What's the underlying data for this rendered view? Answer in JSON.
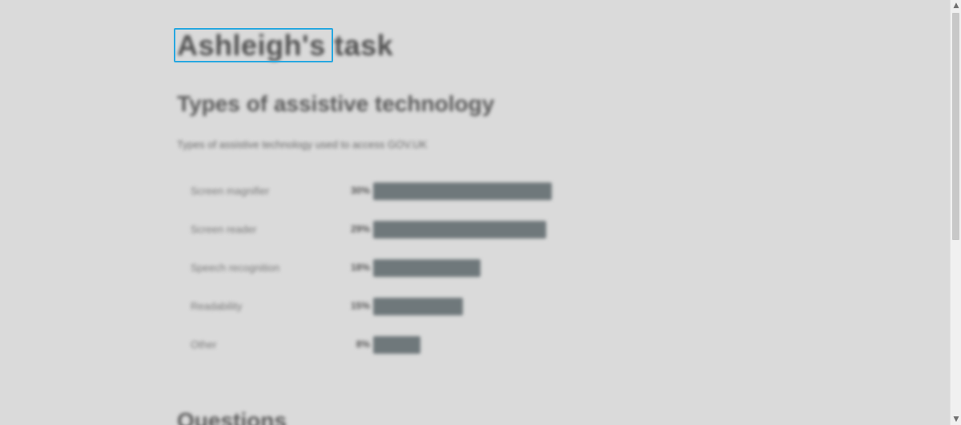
{
  "page": {
    "title": "Ashleigh's task"
  },
  "section": {
    "title": "Types of assistive technology",
    "caption": "Types of assistive technology used to access GOV.UK"
  },
  "chart_data": {
    "type": "bar",
    "orientation": "horizontal",
    "categories": [
      "Screen magnifier",
      "Screen reader",
      "Speech recognition",
      "Readability",
      "Other"
    ],
    "values": [
      30,
      29,
      18,
      15,
      8
    ],
    "value_labels": [
      "30%",
      "29%",
      "18%",
      "15%",
      "8%"
    ],
    "xlim": [
      0,
      30
    ],
    "bar_color": "#6f787b"
  },
  "next_section": {
    "title": "Questions"
  },
  "focus": {
    "color": "#27a7e0"
  },
  "scrollbar": {
    "up_icon": "chevron-up-icon",
    "down_icon": "chevron-down-icon"
  }
}
